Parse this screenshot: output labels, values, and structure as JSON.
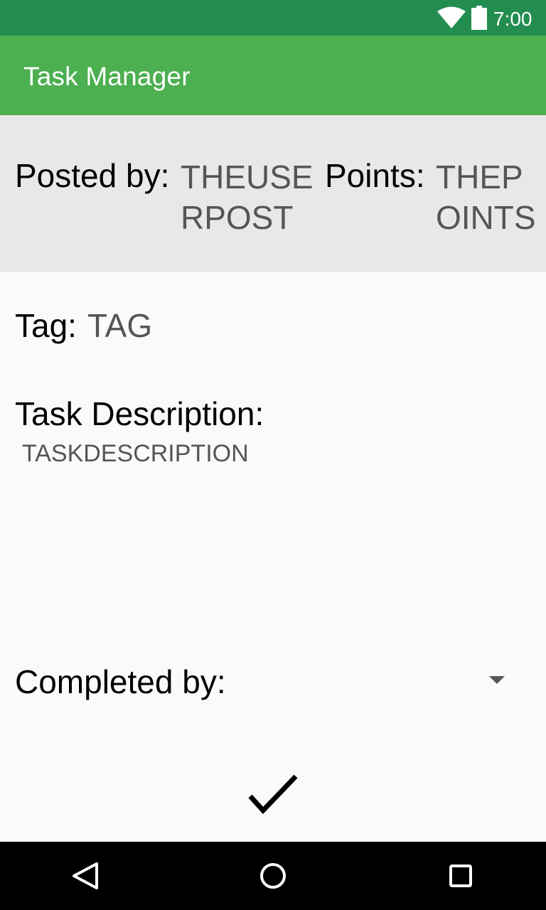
{
  "status_bar": {
    "time": "7:00",
    "icons": [
      "wifi-icon",
      "battery-icon"
    ]
  },
  "app_bar": {
    "title": "Task Manager"
  },
  "task": {
    "posted_by_label": "Posted by:",
    "posted_by_value": "THEUSERPOST",
    "points_label": "Points:",
    "points_value": "THEPOINTS",
    "tag_label": "Tag:",
    "tag_value": "TAG",
    "description_label": "Task Description:",
    "description_value": "TASKDESCRIPTION",
    "completed_by_label": "Completed by:"
  },
  "actions": {
    "confirm_icon": "checkmark-icon"
  },
  "nav_bar": {
    "icons": [
      "back-icon",
      "home-icon",
      "recents-icon"
    ]
  },
  "colors": {
    "status_bar": "#238D50",
    "app_bar": "#4CAF50",
    "header_panel": "#E8E8E8",
    "background": "#FAFAFA",
    "nav_bar": "#000000"
  }
}
